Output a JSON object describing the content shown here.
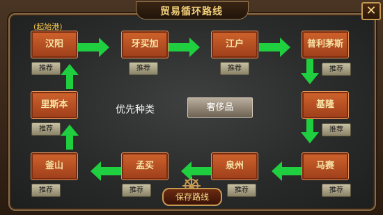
{
  "window": {
    "title": "贸易循环路线",
    "close_icon": "close-icon"
  },
  "start_label": "(起始港)",
  "cities": [
    {
      "name": "汉阳",
      "recommend": "推荐"
    },
    {
      "name": "牙买加",
      "recommend": "推荐"
    },
    {
      "name": "江户",
      "recommend": "推荐"
    },
    {
      "name": "普利茅斯",
      "recommend": "推荐"
    },
    {
      "name": "基隆",
      "recommend": "推荐"
    },
    {
      "name": "马赛",
      "recommend": "推荐"
    },
    {
      "name": "泉州",
      "recommend": "推荐"
    },
    {
      "name": "孟买",
      "recommend": "推荐"
    },
    {
      "name": "釜山",
      "recommend": "推荐"
    },
    {
      "name": "里斯本",
      "recommend": "推荐"
    }
  ],
  "priority": {
    "label": "优先种类",
    "value": "奢侈品"
  },
  "save_label": "保存路线",
  "colors": {
    "arrow": "#1fcf3f",
    "city": "#c45a26",
    "title": "#f2cf7a"
  }
}
